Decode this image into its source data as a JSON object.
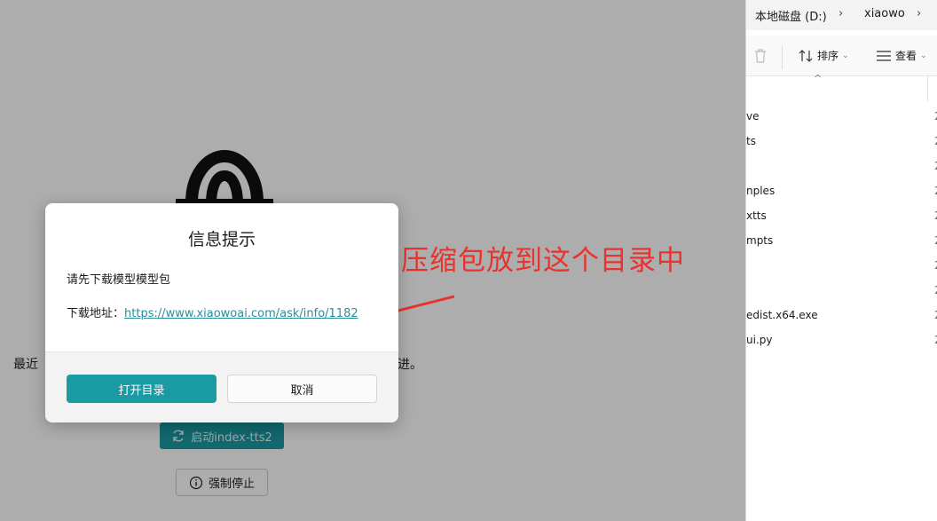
{
  "app": {
    "desc_left": "最近",
    "desc_right": "进。",
    "start_label": "启动index-tts2",
    "stop_label": "强制停止"
  },
  "explorer": {
    "breadcrumb": [
      "本地磁盘 (D:)",
      "xiaowo"
    ],
    "sort_label": "排序",
    "view_label": "查看",
    "files": [
      {
        "name": "ve",
        "date": "2"
      },
      {
        "name": "ts",
        "date": "2"
      },
      {
        "name": "",
        "date": "2"
      },
      {
        "name": "nples",
        "date": "2"
      },
      {
        "name": "xtts",
        "date": "2"
      },
      {
        "name": "mpts",
        "date": "2"
      },
      {
        "name": "",
        "date": "2"
      },
      {
        "name": "",
        "date": "2"
      },
      {
        "name": "edist.x64.exe",
        "date": "2"
      },
      {
        "name": "ui.py",
        "date": "2"
      }
    ]
  },
  "annotation": {
    "text": "压缩包放到这个目录中",
    "color": "#e8322e"
  },
  "dialog": {
    "title": "信息提示",
    "message": "请先下载模型模型包",
    "download_label": "下载地址：",
    "download_url": "https://www.xiaowoai.com/ask/info/1182",
    "ok_label": "打开目录",
    "cancel_label": "取消"
  },
  "colors": {
    "accent": "#1a9aa3",
    "link": "#2a8e98",
    "overlay": "rgba(0,0,0,0.32)"
  }
}
